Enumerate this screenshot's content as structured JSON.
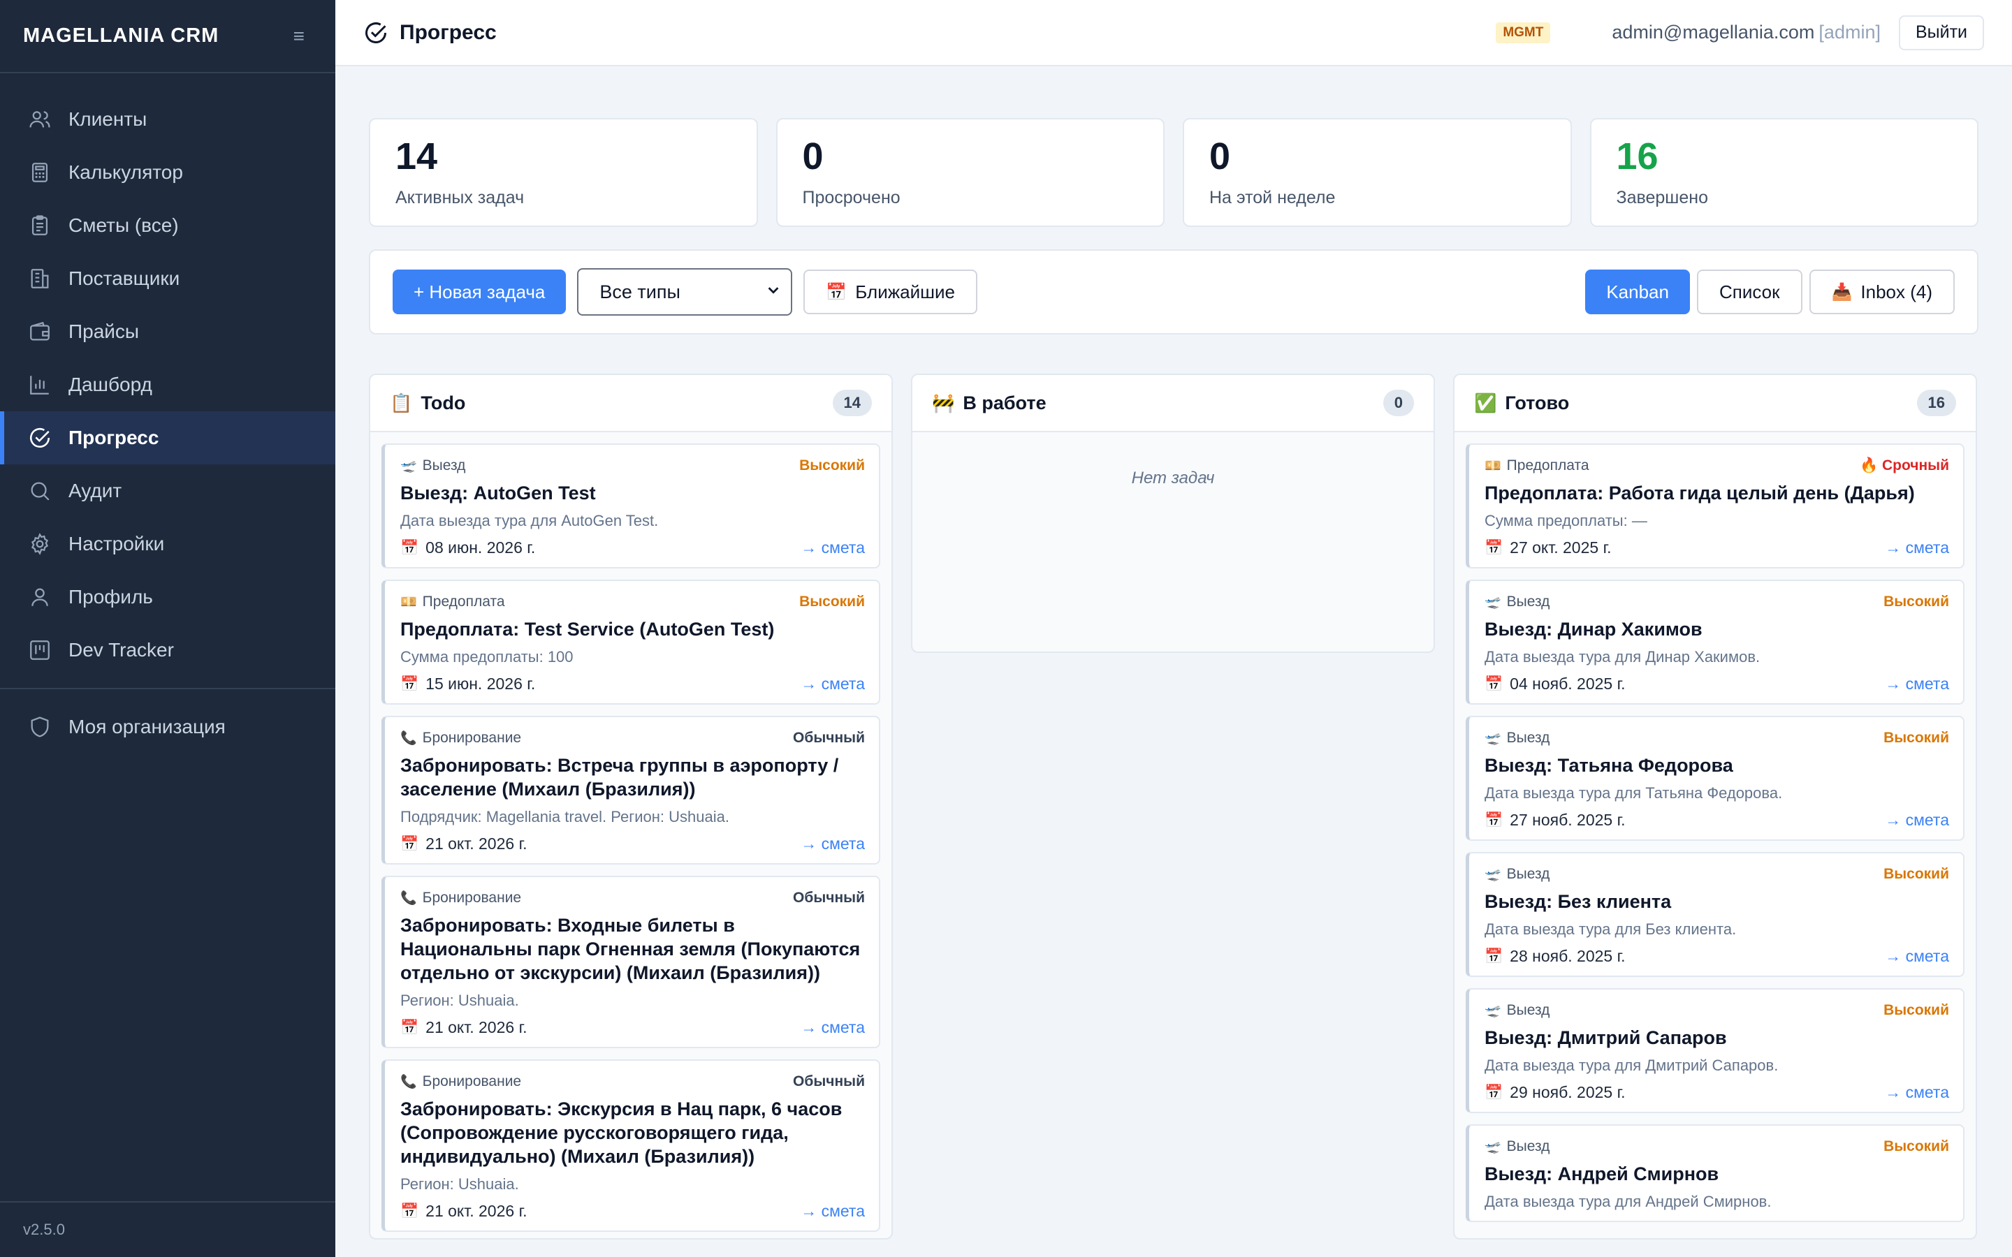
{
  "brand": {
    "name": "MAGELLANIA CRM",
    "toggle_icon": "≡"
  },
  "sidebar": {
    "items": [
      {
        "label": "Клиенты",
        "icon": "users-icon"
      },
      {
        "label": "Калькулятор",
        "icon": "calculator-icon"
      },
      {
        "label": "Сметы (все)",
        "icon": "clipboard-icon"
      },
      {
        "label": "Поставщики",
        "icon": "building-icon"
      },
      {
        "label": "Прайсы",
        "icon": "wallet-icon"
      },
      {
        "label": "Дашборд",
        "icon": "bar-chart-icon"
      },
      {
        "label": "Прогресс",
        "icon": "check-circle-icon",
        "active": true
      },
      {
        "label": "Аудит",
        "icon": "search-icon"
      },
      {
        "label": "Настройки",
        "icon": "gear-icon"
      },
      {
        "label": "Профиль",
        "icon": "user-icon"
      },
      {
        "label": "Dev Tracker",
        "icon": "kanban-icon"
      }
    ],
    "org_item": {
      "label": "Моя организация",
      "icon": "shield-icon"
    },
    "version": "v2.5.0"
  },
  "topbar": {
    "title": "Прогресс",
    "badge": "MGMT",
    "email": "admin@magellania.com",
    "role": "[admin]",
    "logout": "Выйти"
  },
  "stats": [
    {
      "value": "14",
      "label": "Активных задач"
    },
    {
      "value": "0",
      "label": "Просрочено"
    },
    {
      "value": "0",
      "label": "На этой неделе"
    },
    {
      "value": "16",
      "label": "Завершено",
      "color": "#16a34a"
    }
  ],
  "toolbar": {
    "new_task": "+ Новая задача",
    "type_filter": "Все типы",
    "nearest_emoji": "📅",
    "nearest": "Ближайшие",
    "kanban": "Kanban",
    "list": "Список",
    "inbox_emoji": "📥",
    "inbox": "Inbox (4)"
  },
  "columns": [
    {
      "emoji": "📋",
      "title": "Todo",
      "count": "14",
      "cards": [
        {
          "type_emoji": "🛫",
          "type": "Выезд",
          "priority": "Высокий",
          "priority_kind": "high",
          "title": "Выезд: AutoGen Test",
          "desc": "Дата выезда тура для AutoGen Test.",
          "date": "08 июн. 2026 г.",
          "link": "→ смета"
        },
        {
          "type_emoji": "💴",
          "type": "Предоплата",
          "priority": "Высокий",
          "priority_kind": "high",
          "title": "Предоплата: Test Service (AutoGen Test)",
          "desc": "Сумма предоплаты: 100",
          "date": "15 июн. 2026 г.",
          "link": "→ смета"
        },
        {
          "type_emoji": "📞",
          "type": "Бронирование",
          "priority": "Обычный",
          "priority_kind": "normal",
          "title": "Забронировать: Встреча группы в аэропорту / заселение (Михаил (Бразилия))",
          "desc": "Подрядчик: Magellania travel. Регион: Ushuaia.",
          "date": "21 окт. 2026 г.",
          "link": "→ смета"
        },
        {
          "type_emoji": "📞",
          "type": "Бронирование",
          "priority": "Обычный",
          "priority_kind": "normal",
          "title": "Забронировать: Входные билеты в Национальны парк Огненная земля (Покупаются отдельно от экскурсии) (Михаил (Бразилия))",
          "desc": "Регион: Ushuaia.",
          "date": "21 окт. 2026 г.",
          "link": "→ смета"
        },
        {
          "type_emoji": "📞",
          "type": "Бронирование",
          "priority": "Обычный",
          "priority_kind": "normal",
          "title": "Забронировать: Экскурсия в Нац парк, 6 часов (Сопровождение русскоговорящего гида, индивидуально) (Михаил (Бразилия))",
          "desc": "Регион: Ushuaia.",
          "date": "21 окт. 2026 г.",
          "link": "→ смета"
        }
      ]
    },
    {
      "emoji": "🚧",
      "title": "В работе",
      "count": "0",
      "empty": "Нет задач",
      "cards": []
    },
    {
      "emoji": "✅",
      "title": "Готово",
      "count": "16",
      "cards": [
        {
          "type_emoji": "💴",
          "type": "Предоплата",
          "priority": "🔥 Срочный",
          "priority_kind": "urgent",
          "title": "Предоплата: Работа гида целый день (Дарья)",
          "desc": "Сумма предоплаты: —",
          "date": "27 окт. 2025 г.",
          "link": "→ смета"
        },
        {
          "type_emoji": "🛫",
          "type": "Выезд",
          "priority": "Высокий",
          "priority_kind": "high",
          "title": "Выезд: Динар Хакимов",
          "desc": "Дата выезда тура для Динар Хакимов.",
          "date": "04 нояб. 2025 г.",
          "link": "→ смета"
        },
        {
          "type_emoji": "🛫",
          "type": "Выезд",
          "priority": "Высокий",
          "priority_kind": "high",
          "title": "Выезд: Татьяна Федорова",
          "desc": "Дата выезда тура для Татьяна Федорова.",
          "date": "27 нояб. 2025 г.",
          "link": "→ смета"
        },
        {
          "type_emoji": "🛫",
          "type": "Выезд",
          "priority": "Высокий",
          "priority_kind": "high",
          "title": "Выезд: Без клиента",
          "desc": "Дата выезда тура для Без клиента.",
          "date": "28 нояб. 2025 г.",
          "link": "→ смета"
        },
        {
          "type_emoji": "🛫",
          "type": "Выезд",
          "priority": "Высокий",
          "priority_kind": "high",
          "title": "Выезд: Дмитрий Сапаров",
          "desc": "Дата выезда тура для Дмитрий Сапаров.",
          "date": "29 нояб. 2025 г.",
          "link": "→ смета"
        },
        {
          "type_emoji": "🛫",
          "type": "Выезд",
          "priority": "Высокий",
          "priority_kind": "high",
          "title": "Выезд: Андрей Смирнов",
          "desc": "Дата выезда тура для Андрей Смирнов.",
          "date": "",
          "link": ""
        }
      ]
    }
  ],
  "date_emoji": "📅",
  "colors": {
    "accent": "#3b82f6",
    "sidebar": "#1e293b",
    "success": "#16a34a",
    "high": "#d97706",
    "urgent": "#dc2626"
  }
}
